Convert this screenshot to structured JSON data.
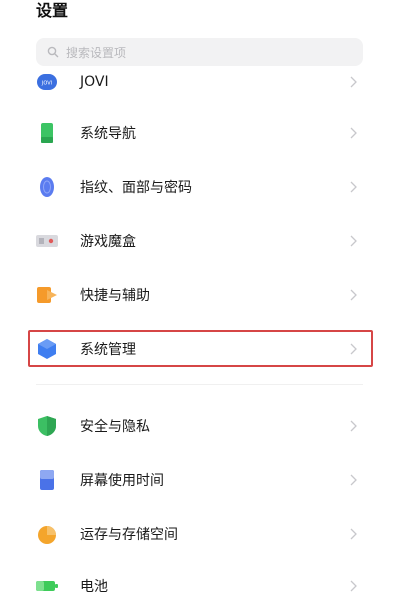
{
  "header": {
    "title": "设置"
  },
  "search": {
    "placeholder": "搜索设置项"
  },
  "items": [
    {
      "label": "JOVI",
      "icon": "jovi-icon"
    },
    {
      "label": "系统导航",
      "icon": "phone-navigation-icon"
    },
    {
      "label": "指纹、面部与密码",
      "icon": "fingerprint-icon"
    },
    {
      "label": "游戏魔盒",
      "icon": "game-box-icon"
    },
    {
      "label": "快捷与辅助",
      "icon": "shortcut-icon"
    },
    {
      "label": "系统管理",
      "icon": "system-management-icon"
    },
    {
      "label": "安全与隐私",
      "icon": "security-shield-icon"
    },
    {
      "label": "屏幕使用时间",
      "icon": "screen-time-icon"
    },
    {
      "label": "运存与存储空间",
      "icon": "storage-pie-icon"
    },
    {
      "label": "电池",
      "icon": "battery-icon"
    }
  ],
  "colors": {
    "highlight_border": "#d64646",
    "jovi": "#3b6fe0",
    "navigation": "#3cc464",
    "fingerprint": "#5b7cf0",
    "game": "#e05a5a",
    "shortcut": "#f59a2a",
    "system": "#3f7ef0",
    "security": "#3cbf63",
    "screen_time": "#4a72e8",
    "storage": "#f4a52c",
    "battery": "#3ecb5a"
  }
}
